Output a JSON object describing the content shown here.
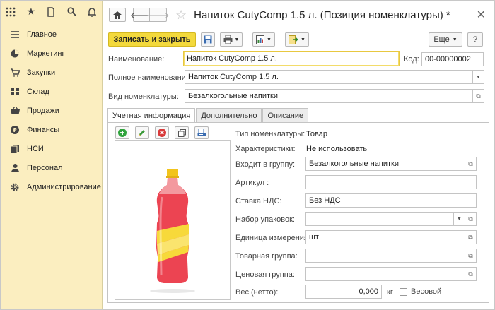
{
  "sidebar": {
    "items": [
      {
        "label": "Главное",
        "icon": "menu-icon"
      },
      {
        "label": "Маркетинг",
        "icon": "pie-chart-icon"
      },
      {
        "label": "Закупки",
        "icon": "cart-icon"
      },
      {
        "label": "Склад",
        "icon": "warehouse-icon"
      },
      {
        "label": "Продажи",
        "icon": "basket-icon"
      },
      {
        "label": "Финансы",
        "icon": "ruble-icon"
      },
      {
        "label": "НСИ",
        "icon": "documents-icon"
      },
      {
        "label": "Персонал",
        "icon": "person-icon"
      },
      {
        "label": "Администрирование",
        "icon": "settings-icon"
      }
    ]
  },
  "header": {
    "title": "Напиток CutyComp 1.5 л. (Позиция номенклатуры) *"
  },
  "toolbar": {
    "save_close": "Записать и закрыть",
    "more": "Еще",
    "help": "?"
  },
  "form": {
    "name_label": "Наименование:",
    "name_value": "Напиток CutyComp 1.5 л.",
    "code_label": "Код:",
    "code_value": "00-00000002",
    "fullname_label": "Полное наименование:",
    "fullname_value": "Напиток CutyComp 1.5 л.",
    "kind_label": "Вид номенклатуры:",
    "kind_value": "Безалкогольные напитки"
  },
  "tabs": [
    "Учетная информация",
    "Дополнительно",
    "Описание"
  ],
  "details": {
    "type_label": "Тип номенклатуры:",
    "type_value": "Товар",
    "char_label": "Характеристики:",
    "char_value": "Не использовать",
    "group_label": "Входит в группу:",
    "group_value": "Безалкогольные напитки",
    "article_label": "Артикул :",
    "article_value": "",
    "vat_label": "Ставка НДС:",
    "vat_value": "Без НДС",
    "pack_label": "Набор упаковок:",
    "pack_value": "",
    "unit_label": "Единица измерения:",
    "unit_value": "шт",
    "prodgroup_label": "Товарная группа:",
    "prodgroup_value": "",
    "pricegroup_label": "Ценовая группа:",
    "pricegroup_value": "",
    "weight_label": "Вес (нетто):",
    "weight_value": "0,000",
    "weight_unit": "кг",
    "weighted_label": "Весовой"
  },
  "colors": {
    "sidebar_bg": "#fbeec0",
    "primary_button": "#f3d93c",
    "bottle_red": "#e8404a",
    "bottle_yellow": "#f6d430"
  }
}
